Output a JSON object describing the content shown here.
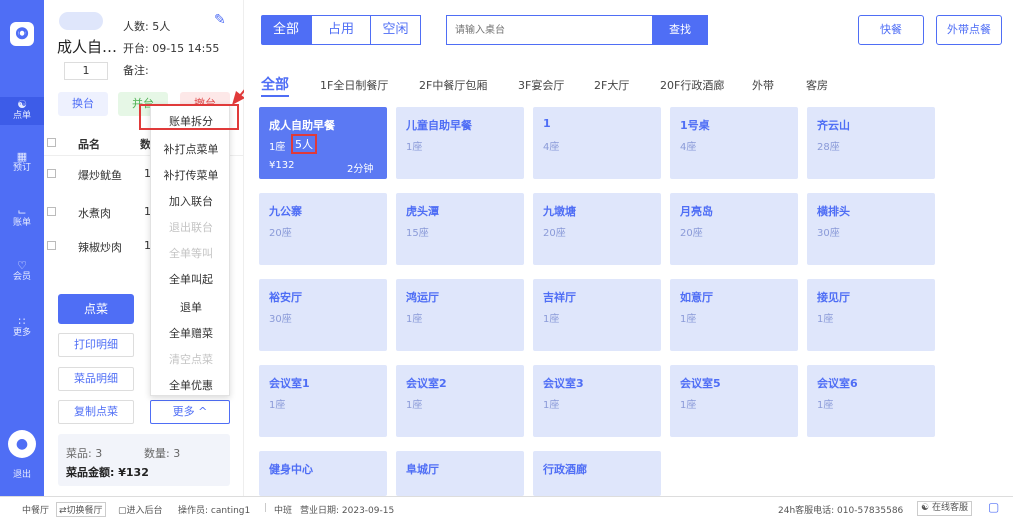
{
  "nav": {
    "items": [
      {
        "label": "点单",
        "icon": "food-icon"
      },
      {
        "label": "预订",
        "icon": "calendar-icon"
      },
      {
        "label": "账单",
        "icon": "chart-icon"
      },
      {
        "label": "会员",
        "icon": "member-icon"
      },
      {
        "label": "更多",
        "icon": "grid-icon"
      }
    ],
    "logout": "退出"
  },
  "order": {
    "table_name": "成人自…",
    "people": "人数: 5人",
    "opened": "开台: 09-15 14:55",
    "note": "备注:",
    "qty": "1",
    "buttons": {
      "change": "换台",
      "merge": "并台",
      "cancel": "撤台"
    },
    "columns": {
      "name": "品名",
      "qty": "数"
    },
    "items": [
      {
        "name": "爆炒鱿鱼",
        "qty": "1"
      },
      {
        "name": "水煮肉",
        "qty": "1"
      },
      {
        "name": "辣椒炒肉",
        "qty": "1"
      }
    ],
    "actions": {
      "order": "点菜",
      "print_detail": "打印明细",
      "dish_detail": "菜品明细",
      "copy_dish": "复制点菜",
      "more": "更多 ^"
    },
    "summary": {
      "dishes": "菜品: 3",
      "count": "数量: 3",
      "amount": "菜品金额: ¥132"
    }
  },
  "dropdown": {
    "items": [
      {
        "label": "账单拆分",
        "enabled": true
      },
      {
        "label": "补打点菜单",
        "enabled": true
      },
      {
        "label": "补打传菜单",
        "enabled": true
      },
      {
        "label": "加入联台",
        "enabled": true
      },
      {
        "label": "退出联台",
        "enabled": false
      },
      {
        "label": "全单等叫",
        "enabled": false
      },
      {
        "label": "全单叫起",
        "enabled": true
      },
      {
        "label": "退单",
        "enabled": true
      },
      {
        "label": "全单赠菜",
        "enabled": true
      },
      {
        "label": "清空点菜",
        "enabled": false
      },
      {
        "label": "全单优惠",
        "enabled": true
      }
    ]
  },
  "filter": {
    "all": "全部",
    "occupied": "占用",
    "free": "空闲"
  },
  "search": {
    "placeholder": "请输入桌台",
    "button": "查找"
  },
  "quick": "快餐",
  "takeout": "外带点餐",
  "tabs": [
    "全部",
    "1F全日制餐厅",
    "2F中餐厅包厢",
    "3F宴会厅",
    "2F大厅",
    "20F行政酒廊",
    "外带",
    "客房"
  ],
  "tables": [
    {
      "name": "成人自助早餐",
      "seats": "1座",
      "people": "5人",
      "amount": "¥132",
      "time": "2分钟"
    },
    {
      "name": "儿童自助早餐",
      "seats": "1座"
    },
    {
      "name": "1",
      "seats": "4座"
    },
    {
      "name": "1号桌",
      "seats": "4座"
    },
    {
      "name": "齐云山",
      "seats": "28座"
    },
    {
      "name": "九公寨",
      "seats": "20座"
    },
    {
      "name": "虎头潭",
      "seats": "15座"
    },
    {
      "name": "九墩塘",
      "seats": "20座"
    },
    {
      "name": "月亮岛",
      "seats": "20座"
    },
    {
      "name": "横排头",
      "seats": "30座"
    },
    {
      "name": "裕安厅",
      "seats": "30座"
    },
    {
      "name": "鸿运厅",
      "seats": "1座"
    },
    {
      "name": "吉祥厅",
      "seats": "1座"
    },
    {
      "name": "如意厅",
      "seats": "1座"
    },
    {
      "name": "接见厅",
      "seats": "1座"
    },
    {
      "name": "会议室1",
      "seats": "1座"
    },
    {
      "name": "会议室2",
      "seats": "1座"
    },
    {
      "name": "会议室3",
      "seats": "1座"
    },
    {
      "name": "会议室5",
      "seats": "1座"
    },
    {
      "name": "会议室6",
      "seats": "1座"
    },
    {
      "name": "健身中心",
      "seats": ""
    },
    {
      "name": "阜城厅",
      "seats": ""
    },
    {
      "name": "行政酒廊",
      "seats": ""
    }
  ],
  "status": {
    "restaurant": "中餐厅",
    "switch": "⇄切换餐厅",
    "backend": "▢进入后台",
    "operator": "操作员: canting1",
    "shift": "中班",
    "biz_date": "营业日期: 2023-09-15",
    "hotline": "24h客服电话: 010-57835586",
    "online": "在线客服"
  },
  "colors": {
    "primary": "#4f6ef5",
    "card": "#dfe6fb",
    "highlight": "#e03a3a"
  }
}
